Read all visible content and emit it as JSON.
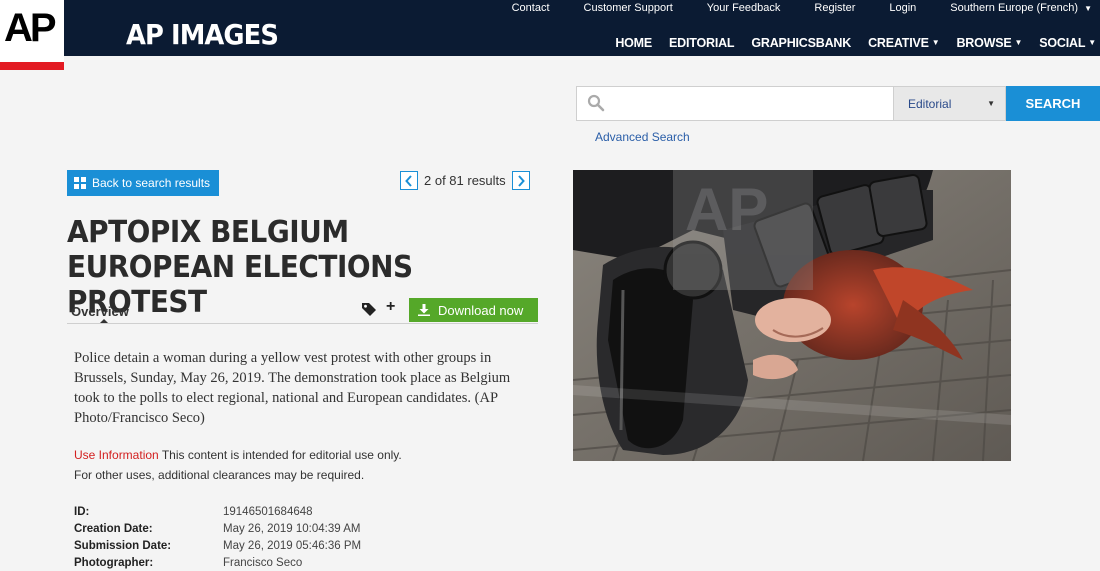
{
  "header": {
    "logo_text": "AP",
    "brand": "AP IMAGES",
    "utility": {
      "contact": "Contact",
      "customer_support": "Customer Support",
      "feedback": "Your Feedback",
      "register": "Register",
      "login": "Login",
      "region": "Southern Europe (French)"
    },
    "nav": {
      "home": "HOME",
      "editorial": "EDITORIAL",
      "graphicsbank": "GRAPHICSBANK",
      "creative": "CREATIVE",
      "browse": "BROWSE",
      "social": "SOCIAL"
    }
  },
  "search": {
    "placeholder": "",
    "scope": "Editorial",
    "button": "SEARCH",
    "advanced": "Advanced Search"
  },
  "detail": {
    "back_label": "Back to search results",
    "pager": "2 of 81 results",
    "title": "APTOPIX BELGIUM EUROPEAN ELECTIONS PROTEST",
    "tab_overview": "Overview",
    "plus": "+",
    "download": "Download now",
    "caption": "Police detain a woman during a yellow vest protest with other groups in Brussels, Sunday, May 26, 2019. The demonstration took place as Belgium took to the polls to elect regional, national and European candidates. (AP Photo/Francisco Seco)",
    "use_info_link": "Use Information",
    "use_info_text": " This content is intended for editorial use only.",
    "use_info_line2": "For other uses, additional clearances may be required.",
    "meta": [
      {
        "key": "ID:",
        "value": "19146501684648"
      },
      {
        "key": "Creation Date:",
        "value": "May 26, 2019 10:04:39 AM"
      },
      {
        "key": "Submission Date:",
        "value": "May 26, 2019 05:46:36 PM"
      },
      {
        "key": "Photographer:",
        "value": "Francisco Seco"
      }
    ]
  },
  "photo": {
    "watermark": "AP"
  },
  "colors": {
    "header_bg": "#0b1b33",
    "accent_blue": "#1a8fd6",
    "download_green": "#55a829",
    "ap_red": "#e31b23"
  }
}
